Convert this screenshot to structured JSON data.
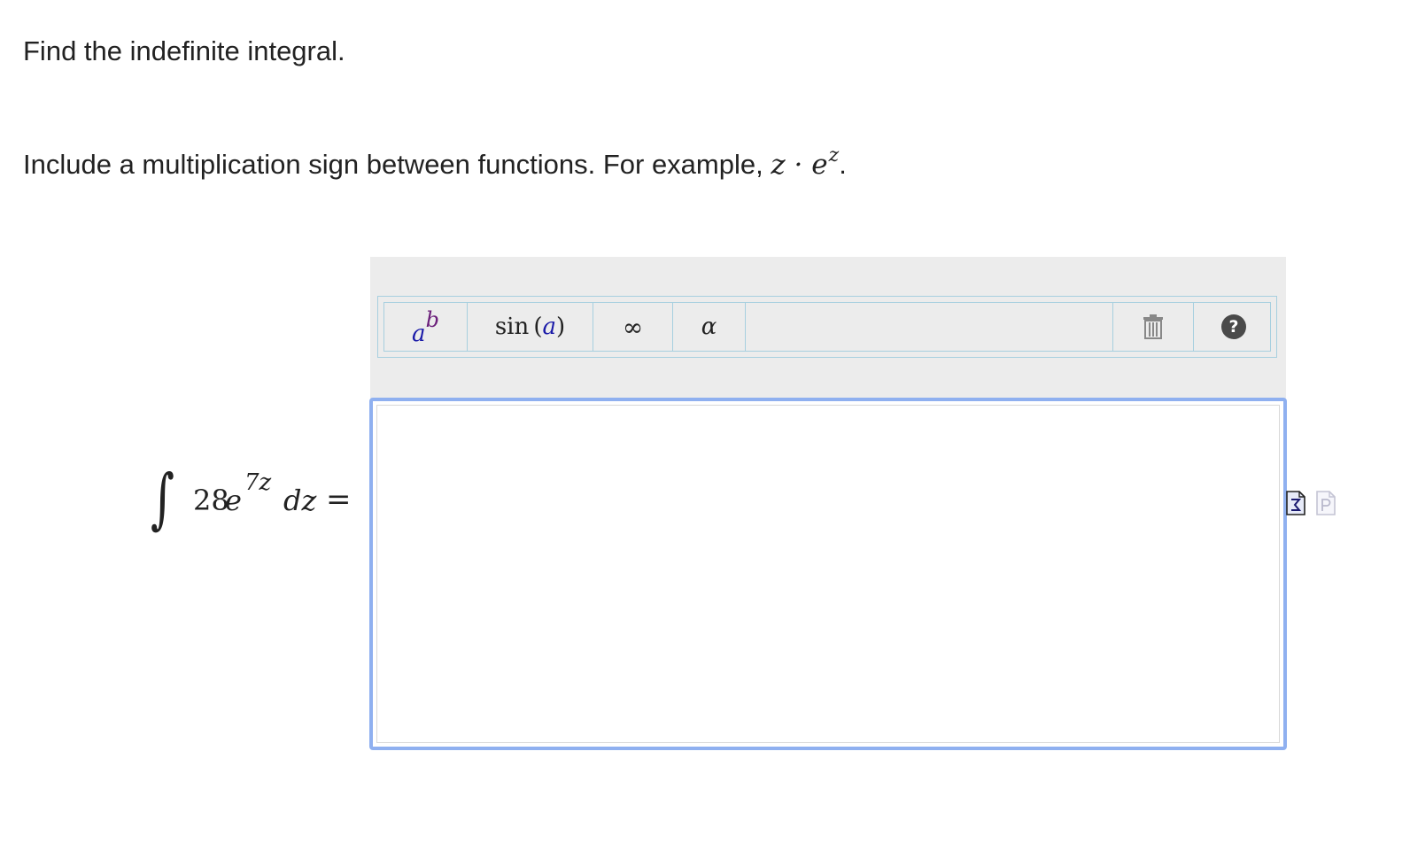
{
  "question": {
    "instruction": "Find the indefinite integral.",
    "hint_prefix": "Include a multiplication sign between functions. For example, ",
    "hint_math_base": "z · e",
    "hint_math_exp": "z",
    "hint_suffix": "."
  },
  "integral": {
    "coefficient": "28",
    "base": "e",
    "exponent": "7z",
    "differential": "dz",
    "equals": "="
  },
  "toolbar": {
    "power_base": "a",
    "power_exp": "b",
    "trig_fn": "sin",
    "trig_open": "(",
    "trig_arg": "a",
    "trig_close": ")",
    "infinity": "∞",
    "alpha": "α",
    "help": "?"
  },
  "answer": {
    "value": ""
  },
  "icons": {
    "power": "power-template-icon",
    "trash": "trash-icon",
    "help": "help-icon",
    "equation_editor": "equation-editor-icon",
    "plain_text": "plain-text-editor-icon"
  },
  "colors": {
    "focus_border": "#8fb0f0",
    "toolbar_border": "#a7cfdf",
    "panel_background": "#ececec",
    "template_variable": "#1a1aa8",
    "template_exponent": "#6b1f7a"
  }
}
